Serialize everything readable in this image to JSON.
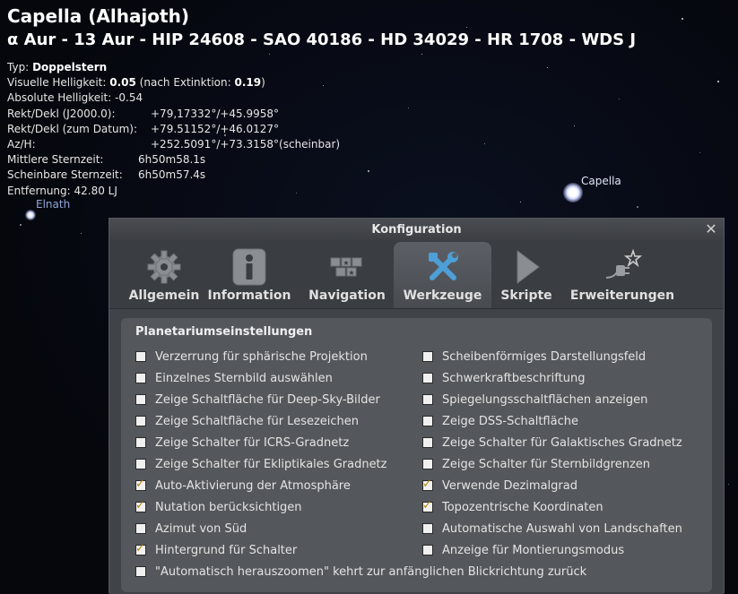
{
  "object": {
    "title": "Capella (Alhajoth)",
    "ids": "α Aur - 13 Aur - HIP 24608 - SAO 40186 - HD 34029 - HR 1708 - WDS J",
    "type_label": "Typ:",
    "type_value": "Doppelstern",
    "vis_mag_label": "Visuelle Helligkeit:",
    "vis_mag_value": "0.05",
    "vis_mag_ext_label": "(nach Extinktion:",
    "vis_mag_ext_value": "0.19",
    "vis_mag_ext_close": ")",
    "abs_mag": "Absolute Helligkeit: -0.54",
    "radec_j2000_label": "Rekt/Dekl (J2000.0):",
    "radec_j2000_value": "+79,17332°/+45.9958°",
    "radec_date_label": "Rekt/Dekl (zum Datum):",
    "radec_date_value": "+79.51152°/+46.0127°",
    "azh_label": "Az/H:",
    "azh_value": "+252.5091°/+73.3158°(scheinbar)",
    "mean_sidereal_label": "Mittlere Sternzeit:",
    "mean_sidereal_value": "6h50m58.1s",
    "app_sidereal_label": "Scheinbare Sternzeit:",
    "app_sidereal_value": "6h50m57.4s",
    "distance": "Entfernung: 42.80 LJ"
  },
  "sky_labels": {
    "elnath": "Elnath",
    "capella": "Capella"
  },
  "dialog": {
    "title": "Konfiguration",
    "close_icon": "close-icon",
    "tabs": [
      {
        "label": "Allgemein",
        "icon": "gear-icon",
        "active": false
      },
      {
        "label": "Information",
        "icon": "info-icon",
        "active": false
      },
      {
        "label": "Navigation",
        "icon": "navigation-keys-icon",
        "active": false
      },
      {
        "label": "Werkzeuge",
        "icon": "tools-icon",
        "active": true
      },
      {
        "label": "Skripte",
        "icon": "play-icon",
        "active": false
      },
      {
        "label": "Erweiterungen",
        "icon": "plugin-icon",
        "active": false
      }
    ],
    "panel_title": "Planetariumseinstellungen",
    "options_left": [
      {
        "label": "Verzerrung für sphärische Projektion",
        "checked": false
      },
      {
        "label": "Einzelnes Sternbild auswählen",
        "checked": false
      },
      {
        "label": "Zeige Schaltfläche für Deep-Sky-Bilder",
        "checked": false
      },
      {
        "label": "Zeige Schaltfläche für Lesezeichen",
        "checked": false
      },
      {
        "label": "Zeige Schalter für ICRS-Gradnetz",
        "checked": false
      },
      {
        "label": "Zeige Schalter für Ekliptikales Gradnetz",
        "checked": false
      },
      {
        "label": "Auto-Aktivierung der Atmosphäre",
        "checked": true
      },
      {
        "label": "Nutation berücksichtigen",
        "checked": true
      },
      {
        "label": "Azimut von Süd",
        "checked": false
      },
      {
        "label": "Hintergrund für Schalter",
        "checked": true
      }
    ],
    "options_right": [
      {
        "label": "Scheibenförmiges Darstellungsfeld",
        "checked": false
      },
      {
        "label": "Schwerkraftbeschriftung",
        "checked": false
      },
      {
        "label": "Spiegelungsschaltflächen anzeigen",
        "checked": false
      },
      {
        "label": "Zeige DSS-Schaltfläche",
        "checked": false
      },
      {
        "label": "Zeige Schalter für Galaktisches Gradnetz",
        "checked": false
      },
      {
        "label": "Zeige Schalter für Sternbildgrenzen",
        "checked": false
      },
      {
        "label": "Verwende Dezimalgrad",
        "checked": true
      },
      {
        "label": "Topozentrische Koordinaten",
        "checked": true
      },
      {
        "label": "Automatische Auswahl von Landschaften",
        "checked": false
      },
      {
        "label": "Anzeige für Montierungsmodus",
        "checked": false
      }
    ],
    "option_full": {
      "label": "\"Automatisch herauszoomen\" kehrt zur anfänglichen Blickrichtung zurück",
      "checked": false
    }
  }
}
